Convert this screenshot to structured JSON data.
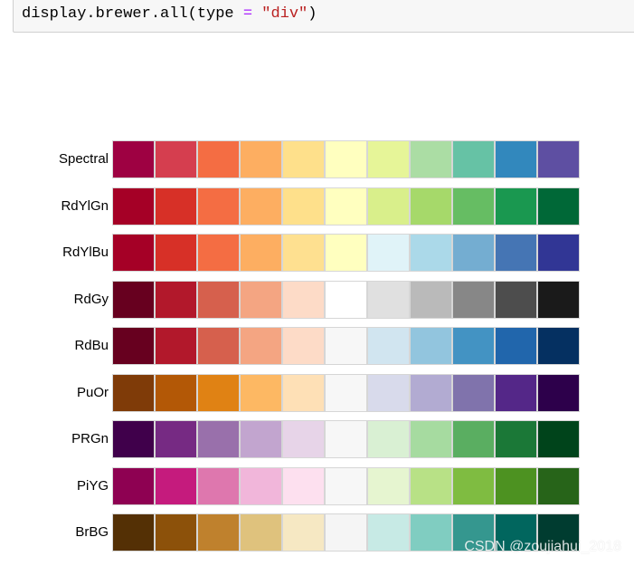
{
  "code_cell": {
    "tokens": [
      {
        "text": "display.brewer.all(type ",
        "kind": "plain"
      },
      {
        "text": "=",
        "kind": "op"
      },
      {
        "text": " ",
        "kind": "plain"
      },
      {
        "text": "\"div\"",
        "kind": "str"
      },
      {
        "text": ")",
        "kind": "plain"
      }
    ]
  },
  "palettes": [
    {
      "name": "Spectral",
      "colors": [
        "#9E0142",
        "#D53E4F",
        "#F46D43",
        "#FDAE61",
        "#FEE08B",
        "#FFFFBF",
        "#E6F598",
        "#ABDDA4",
        "#66C2A5",
        "#3288BD",
        "#5E4FA2"
      ]
    },
    {
      "name": "RdYlGn",
      "colors": [
        "#A50026",
        "#D73027",
        "#F46D43",
        "#FDAE61",
        "#FEE08B",
        "#FFFFBF",
        "#D9EF8B",
        "#A6D96A",
        "#66BD63",
        "#1A9850",
        "#006837"
      ]
    },
    {
      "name": "RdYlBu",
      "colors": [
        "#A50026",
        "#D73027",
        "#F46D43",
        "#FDAE61",
        "#FEE090",
        "#FFFFBF",
        "#E0F3F8",
        "#ABD9E9",
        "#74ADD1",
        "#4575B4",
        "#313695"
      ]
    },
    {
      "name": "RdGy",
      "colors": [
        "#67001F",
        "#B2182B",
        "#D6604D",
        "#F4A582",
        "#FDDBC7",
        "#FFFFFF",
        "#E0E0E0",
        "#BABABA",
        "#878787",
        "#4D4D4D",
        "#1A1A1A"
      ]
    },
    {
      "name": "RdBu",
      "colors": [
        "#67001F",
        "#B2182B",
        "#D6604D",
        "#F4A582",
        "#FDDBC7",
        "#F7F7F7",
        "#D1E5F0",
        "#92C5DE",
        "#4393C3",
        "#2166AC",
        "#053061"
      ]
    },
    {
      "name": "PuOr",
      "colors": [
        "#7F3B08",
        "#B35806",
        "#E08214",
        "#FDB863",
        "#FEE0B6",
        "#F7F7F7",
        "#D8DAEB",
        "#B2ABD2",
        "#8073AC",
        "#542788",
        "#2D004B"
      ]
    },
    {
      "name": "PRGn",
      "colors": [
        "#40004B",
        "#762A83",
        "#9970AB",
        "#C2A5CF",
        "#E7D4E8",
        "#F7F7F7",
        "#D9F0D3",
        "#A6DBA0",
        "#5AAE61",
        "#1B7837",
        "#00441B"
      ]
    },
    {
      "name": "PiYG",
      "colors": [
        "#8E0152",
        "#C51B7D",
        "#DE77AE",
        "#F1B6DA",
        "#FDE0EF",
        "#F7F7F7",
        "#E6F5D0",
        "#B8E186",
        "#7FBC41",
        "#4D9221",
        "#276419"
      ]
    },
    {
      "name": "BrBG",
      "colors": [
        "#543005",
        "#8C510A",
        "#BF812D",
        "#DFC27D",
        "#F6E8C3",
        "#F5F5F5",
        "#C7EAE5",
        "#80CDC1",
        "#35978F",
        "#01665E",
        "#003C30"
      ]
    }
  ],
  "watermark": "CSDN @zoujiahui_2018"
}
